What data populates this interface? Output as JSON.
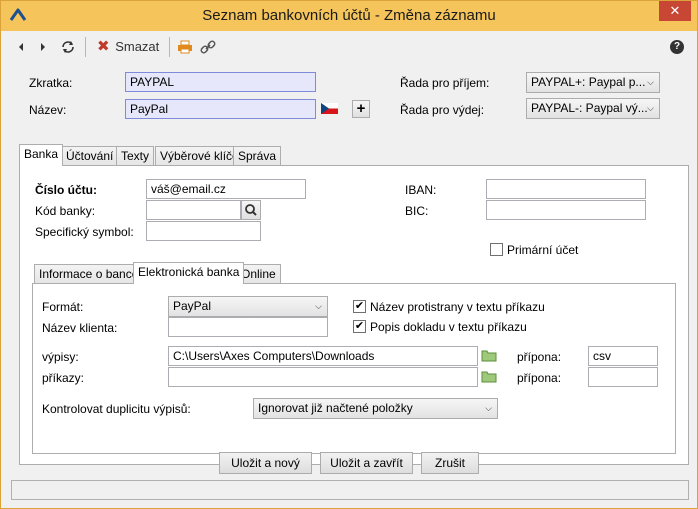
{
  "window": {
    "title": "Seznam bankovních účtů - Změna záznamu",
    "close": "✕"
  },
  "toolbar": {
    "delete_label": "Smazat",
    "help": "?"
  },
  "header": {
    "zkratka_label": "Zkratka:",
    "zkratka_value": "PAYPAL",
    "nazev_label": "Název:",
    "nazev_value": "PayPal",
    "rada_prijem_label": "Řada pro příjem:",
    "rada_prijem_value": "PAYPAL+: Paypal p...",
    "rada_vydej_label": "Řada pro výdej:",
    "rada_vydej_value": "PAYPAL-: Paypal vý..."
  },
  "tabs": [
    "Banka",
    "Účtování",
    "Texty",
    "Výběrové klíče",
    "Správa"
  ],
  "banka": {
    "cislo_label": "Číslo účtu:",
    "cislo_value": "váš@email.cz",
    "kod_label": "Kód banky:",
    "kod_value": "",
    "symbol_label": "Specifický symbol:",
    "symbol_value": "",
    "iban_label": "IBAN:",
    "iban_value": "",
    "bic_label": "BIC:",
    "bic_value": "",
    "primarni_label": "Primární účet"
  },
  "subtabs": [
    "Informace o bance",
    "Elektronická banka",
    "Online"
  ],
  "ebanka": {
    "format_label": "Formát:",
    "format_value": "PayPal",
    "klient_label": "Název klienta:",
    "klient_value": "",
    "protistrana_label": "Název protistrany v textu příkazu",
    "popis_label": "Popis dokladu v textu příkazu",
    "vypisy_label": "výpisy:",
    "vypisy_value": "C:\\Users\\Axes Computers\\Downloads",
    "prikazy_label": "příkazy:",
    "prikazy_value": "",
    "pripona1_label": "přípona:",
    "pripona1_value": "csv",
    "pripona2_label": "přípona:",
    "pripona2_value": "",
    "duplicita_label": "Kontrolovat duplicitu výpisů:",
    "duplicita_value": "Ignorovat již načtené položky"
  },
  "footer": {
    "save_new": "Uložit a nový",
    "save_close": "Uložit a zavřít",
    "cancel": "Zrušit"
  },
  "colors": {
    "title_bar": "#f5c55c",
    "close_button": "#c74634",
    "delete_icon": "#c0392b",
    "print_icon": "#e08a1e"
  }
}
